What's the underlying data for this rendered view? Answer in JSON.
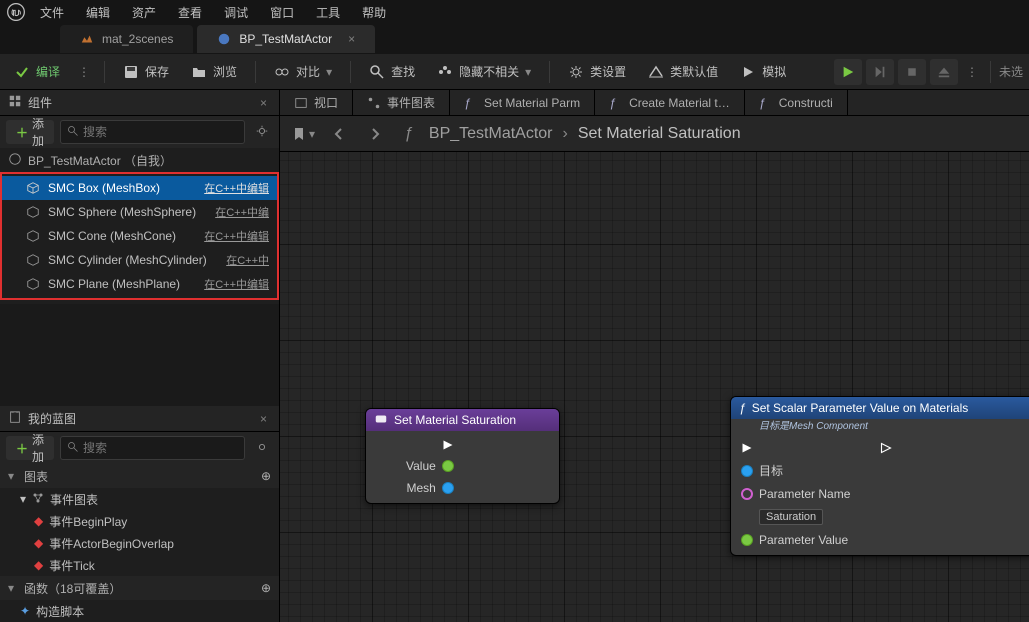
{
  "menu": {
    "items": [
      "文件",
      "编辑",
      "资产",
      "查看",
      "调试",
      "窗口",
      "工具",
      "帮助"
    ]
  },
  "tabs": {
    "t1": {
      "label": "mat_2scenes"
    },
    "t2": {
      "label": "BP_TestMatActor"
    }
  },
  "toolbar": {
    "compile": "编译",
    "save": "保存",
    "browse": "浏览",
    "diff": "对比",
    "find": "查找",
    "hide_unrelated": "隐藏不相关",
    "class_settings": "类设置",
    "class_defaults": "类默认值",
    "simulate": "模拟",
    "untitled": "未选"
  },
  "left": {
    "components_title": "组件",
    "add": "添加",
    "search_placeholder": "搜索",
    "root": {
      "label": "BP_TestMatActor （自我）"
    },
    "items": [
      {
        "label": "SMC Box (MeshBox)",
        "tag": "在C++中编辑",
        "selected": true
      },
      {
        "label": "SMC Sphere (MeshSphere)",
        "tag": "在C++中编"
      },
      {
        "label": "SMC Cone (MeshCone)",
        "tag": "在C++中编辑"
      },
      {
        "label": "SMC Cylinder (MeshCylinder)",
        "tag": "在C++中"
      },
      {
        "label": "SMC Plane (MeshPlane)",
        "tag": "在C++中编辑"
      }
    ],
    "mybp_title": "我的蓝图",
    "cat_graph": "图表",
    "cat_event_graph": "事件图表",
    "ev1": "事件BeginPlay",
    "ev2": "事件ActorBeginOverlap",
    "ev3": "事件Tick",
    "cat_functions": "函数（18可覆盖）",
    "fn1": "构造脚本"
  },
  "right_tabs": {
    "viewport": "视口",
    "event_graph": "事件图表",
    "fn_set_mat_parm": "Set Material Parm",
    "fn_create_mat": "Create Material t…",
    "fn_construct": "Constructi"
  },
  "breadcrumb": {
    "a": "BP_TestMatActor",
    "b": "Set Material Saturation"
  },
  "node1": {
    "title": "Set Material Saturation",
    "pin_value": "Value",
    "pin_mesh": "Mesh"
  },
  "node2": {
    "title": "Set Scalar Parameter Value on Materials",
    "sub": "目标是Mesh Component",
    "pin_target": "目标",
    "pin_param_name": "Parameter Name",
    "pin_param_name_val": "Saturation",
    "pin_param_value": "Parameter Value"
  }
}
